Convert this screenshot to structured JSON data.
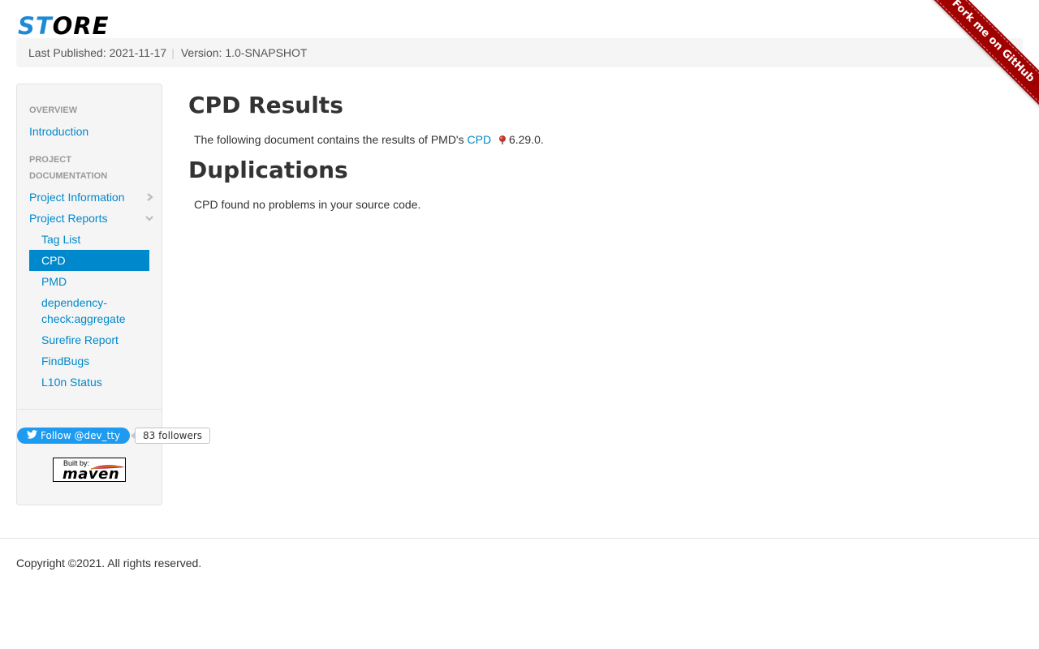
{
  "header": {
    "logo_part1": "ST",
    "logo_part2": "ORE",
    "last_published": "Last Published: 2021-11-17",
    "divider": "|",
    "version": "Version: 1.0-SNAPSHOT"
  },
  "ribbon": {
    "label": "Fork me on GitHub"
  },
  "sidebar": {
    "header_overview": "OVERVIEW",
    "introduction": "Introduction",
    "header_docs": "PROJECT DOCUMENTATION",
    "project_information": "Project Information",
    "project_reports": "Project Reports",
    "reports": [
      {
        "label": "Tag List"
      },
      {
        "label": "CPD"
      },
      {
        "label": "PMD"
      },
      {
        "label": "dependency-check:aggregate"
      },
      {
        "label": "Surefire Report"
      },
      {
        "label": "FindBugs"
      },
      {
        "label": "L10n Status"
      }
    ],
    "twitter_follow": "Follow @dev_tty",
    "twitter_followers": "83 followers",
    "maven_built_by": "Built by:",
    "maven_word": "maven"
  },
  "main": {
    "title": "CPD Results",
    "intro_prefix": "The following document contains the results of PMD's ",
    "intro_link": "CPD",
    "intro_suffix": "6.29.0.",
    "section_title": "Duplications",
    "section_text": "CPD found no problems in your source code."
  },
  "footer": {
    "copyright": "Copyright ©2021. All rights reserved."
  },
  "colors": {
    "link": "#0088cc",
    "active_bg": "#0088cc",
    "ribbon": "#a00000",
    "twitter": "#1d9bf0"
  }
}
